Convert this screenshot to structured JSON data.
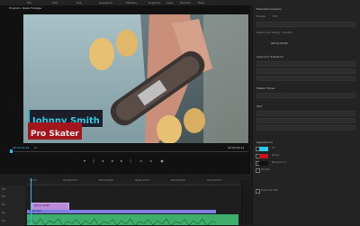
{
  "program": {
    "tab_title": "Program: Skate Footage",
    "timecode_left": "00:00:04:16",
    "fit_label": "Fit",
    "timecode_right": "00:00:25:14"
  },
  "lower_third": {
    "name": "Johnny Smith",
    "title": "Pro Skater",
    "name_color": "#36c8e2",
    "title_bg": "#a4161d"
  },
  "panel": {
    "tab_title": "Essential Graphics",
    "sections": [
      "Browse",
      "Edit"
    ],
    "layer_title": "Johnny Smith",
    "responsive_design": "Responsive Design - Position",
    "align_header": "Align and Transform",
    "master_styles": "Master Styles",
    "text_header": "Text",
    "appearance_header": "Appearance",
    "appearance_items": [
      "Fill",
      "Stroke",
      "Background",
      "Shadow"
    ],
    "mask_label": "Mask with Text",
    "swatch_colors": [
      "#2fc9e6",
      "#c0161f",
      "#101010"
    ]
  },
  "controls": [
    "marker-icon",
    "step-back-icon",
    "prev-edit-icon",
    "play-icon",
    "next-edit-icon",
    "step-forward-icon",
    "insert-icon",
    "overwrite-icon",
    "export-frame-icon"
  ],
  "timeline": {
    "ruler_ticks": [
      "00:00",
      "00:00:05:00",
      "00:00:10:00",
      "00:00:15:00",
      "00:00:20:00",
      "00:00:25:00"
    ],
    "track_labels": [
      "V3",
      "V2",
      "V1",
      "A1",
      "A2"
    ],
    "graphic_clip_label": "Johnny Smith",
    "video_clip_label": "Skate.mp4"
  },
  "menu": [
    "File",
    "Edit",
    "Clip",
    "Sequence",
    "Markers",
    "Graphics",
    "View",
    "Window",
    "Help"
  ]
}
